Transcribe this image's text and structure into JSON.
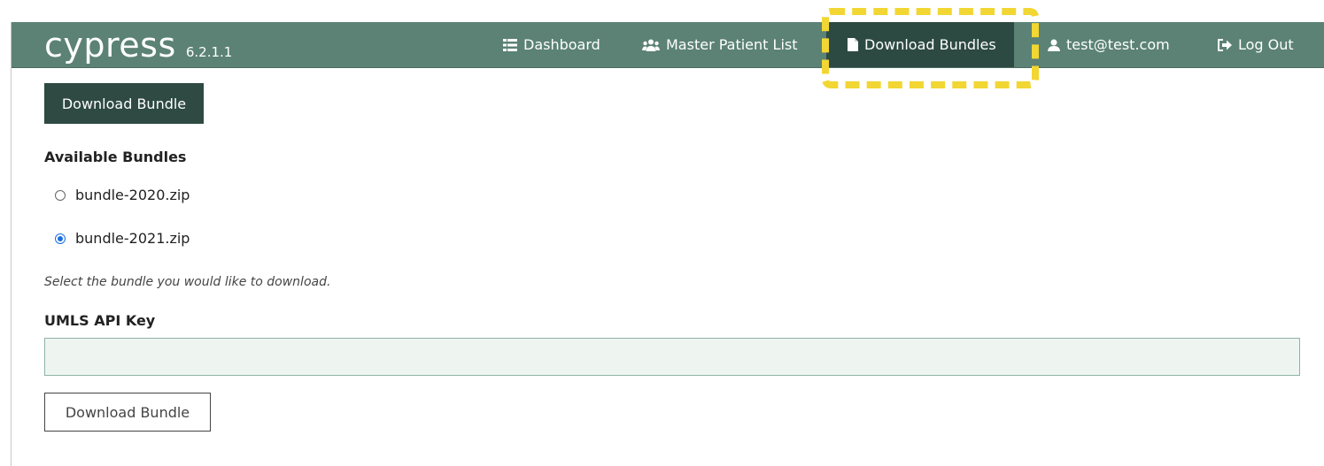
{
  "navbar": {
    "brand": "cypress",
    "version": "6.2.1.1",
    "items": [
      {
        "label": "Dashboard",
        "icon": "list-icon"
      },
      {
        "label": "Master Patient List",
        "icon": "users-icon"
      },
      {
        "label": "Download Bundles",
        "icon": "file-icon",
        "active": true
      },
      {
        "label": "test@test.com",
        "icon": "user-icon"
      },
      {
        "label": "Log Out",
        "icon": "sign-out-icon"
      }
    ]
  },
  "main": {
    "top_button": "Download Bundle",
    "bundles_heading": "Available Bundles",
    "bundles": [
      {
        "label": "bundle-2020.zip",
        "checked": false
      },
      {
        "label": "bundle-2021.zip",
        "checked": true
      }
    ],
    "help_text": "Select the bundle you would like to download.",
    "api_key_label": "UMLS API Key",
    "api_key_value": "",
    "bottom_button": "Download Bundle"
  },
  "colors": {
    "navbar": "#5b8275",
    "active_tab": "#2d4a42",
    "highlight": "#f2d633",
    "radio_checked": "#1a6ee0"
  }
}
